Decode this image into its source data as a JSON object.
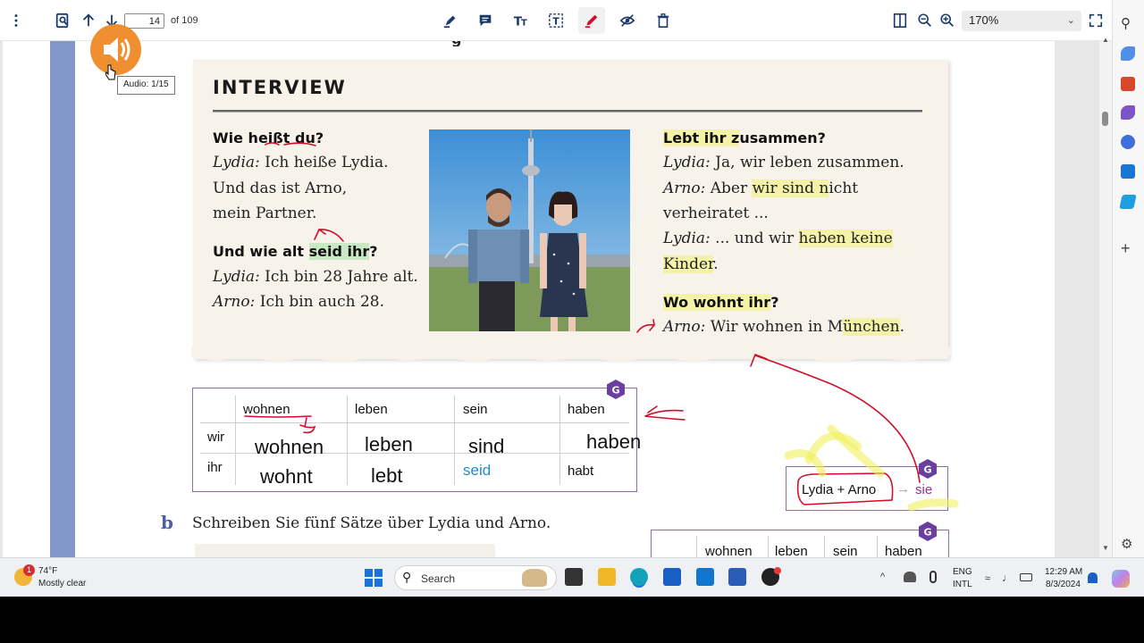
{
  "toolbar": {
    "page_current": "14",
    "page_total": "of 109",
    "zoom": "170%"
  },
  "audio": {
    "tooltip": "Audio: 1/15"
  },
  "interview": {
    "title": "INTERVIEW",
    "left": {
      "q1": "Wie heißt du?",
      "l1_speaker": "Lydia:",
      "l1_text": " Ich heiße Lydia.",
      "l2": "Und das ist Arno,",
      "l3": "mein Partner.",
      "q2_pre": "Und wie alt ",
      "q2_hl": "seid ihr",
      "q2_post": "?",
      "l4_speaker": "Lydia:",
      "l4_text": " Ich bin 28 Jahre alt.",
      "l5_speaker": "Arno:",
      "l5_text": " Ich bin auch 28."
    },
    "right": {
      "q1_hl": "Lebt ihr z",
      "q1_rest": "usammen?",
      "r1_speaker": "Lydia:",
      "r1_text": " Ja, wir leben zusammen.",
      "r2_speaker": "Arno:",
      "r2_pre": " Aber ",
      "r2_hl": "wir sind n",
      "r2_post": "icht",
      "r3": "verheiratet ...",
      "r4_speaker": "Lydia:",
      "r4_pre": " ... und wir ",
      "r4_hl": "haben keine",
      "r5_hl": "Kinder",
      "r5_post": ".",
      "q2_hl": "Wo wohnt ihr",
      "q2_post": "?",
      "r6_speaker": "Arno:",
      "r6_pre": " Wir wohnen in M",
      "r6_hl": "ünchen",
      "r6_post": "."
    }
  },
  "verb_table": {
    "headers": [
      "wohnen",
      "leben",
      "sein",
      "haben"
    ],
    "rows": [
      {
        "person": "wir",
        "values": [
          "wohnen",
          "leben",
          "sind",
          "haben"
        ]
      },
      {
        "person": "ihr",
        "values": [
          "wohnt",
          "lebt",
          "seid",
          "habt"
        ]
      }
    ],
    "badge": "G"
  },
  "section_b": {
    "letter": "b",
    "text": "Schreiben Sie fünf Sätze über Lydia und Arno."
  },
  "box2": {
    "left": "Lydia + Arno",
    "arrow": "→",
    "right": "sie",
    "badge": "G"
  },
  "table2": {
    "headers": [
      "wohnen",
      "leben",
      "sein",
      "haben"
    ],
    "badge": "G"
  },
  "taskbar": {
    "weather_temp": "74°F",
    "weather_desc": "Mostly clear",
    "weather_badge": "1",
    "search_placeholder": "Search",
    "lang1": "ENG",
    "lang2": "INTL",
    "time": "12:29 AM",
    "date": "8/3/2024"
  },
  "colors": {
    "accent_red": "#d0102a",
    "highlight_yellow": "#f0f05a",
    "band_blue": "#8296c9",
    "badge_purple": "#6b3fa0",
    "audio_orange": "#ef8f2f"
  }
}
